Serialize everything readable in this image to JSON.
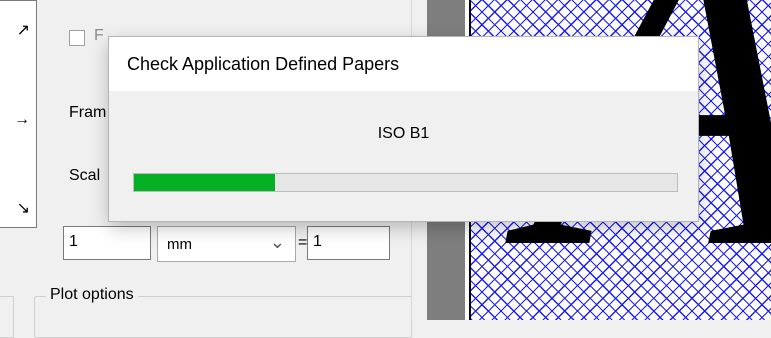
{
  "settings": {
    "checkbox_label": "F",
    "frame_label": "Fram",
    "scale_label": "Scal",
    "scale_left_value": "1",
    "unit": "mm",
    "equals": "=",
    "scale_right_value": "1",
    "plot_options_label": "Plot options"
  },
  "dialog": {
    "title": "Check Application Defined Papers",
    "message": "ISO B1",
    "progress": 0.26,
    "progress_color": "#06b025"
  },
  "preview": {
    "glyph": "A",
    "hatch_color": "#1a1aff"
  },
  "icons": {
    "top_arrow": "diagonal-up-right-arrow-icon",
    "middle_arrow": "right-arrow-icon",
    "bottom_arrow": "diagonal-down-right-arrow-icon",
    "dropdown": "chevron-down-icon"
  }
}
